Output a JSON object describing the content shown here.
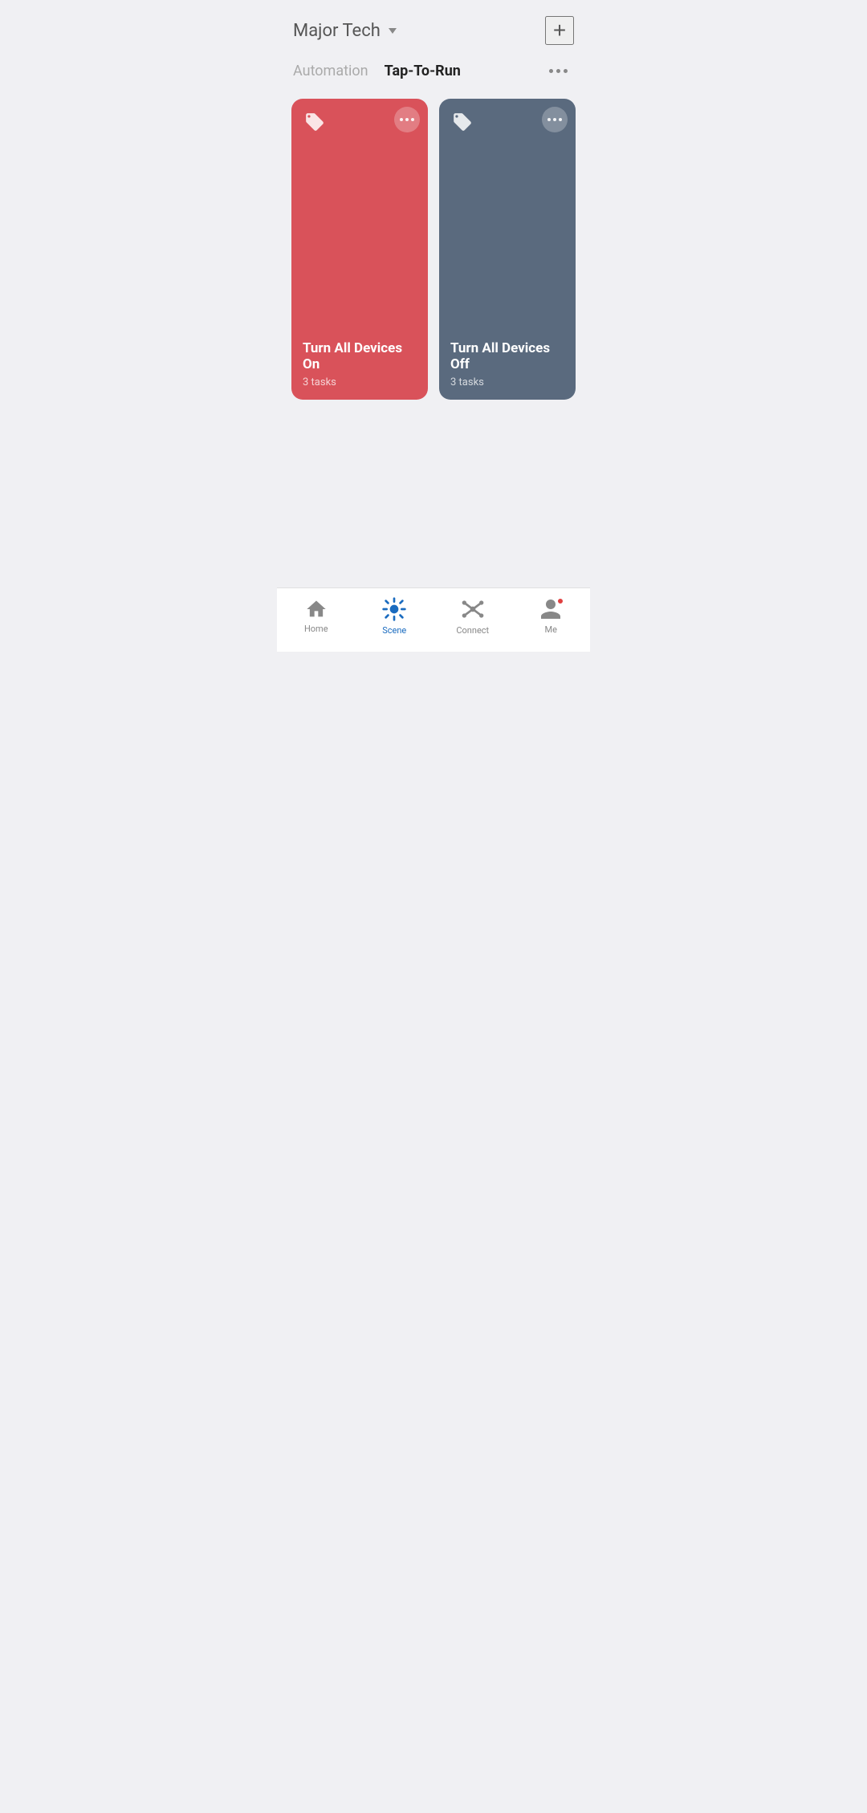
{
  "header": {
    "title": "Major Tech",
    "add_button_label": "+"
  },
  "tabs": [
    {
      "id": "automation",
      "label": "Automation",
      "active": false
    },
    {
      "id": "tap-to-run",
      "label": "Tap-To-Run",
      "active": true
    }
  ],
  "cards": [
    {
      "id": "turn-all-on",
      "title": "Turn All Devices On",
      "subtitle": "3 tasks",
      "color": "on"
    },
    {
      "id": "turn-all-off",
      "title": "Turn All Devices Off",
      "subtitle": "3 tasks",
      "color": "off"
    }
  ],
  "bottom_nav": [
    {
      "id": "home",
      "label": "Home",
      "active": false
    },
    {
      "id": "scene",
      "label": "Scene",
      "active": true
    },
    {
      "id": "connect",
      "label": "Connect",
      "active": false
    },
    {
      "id": "me",
      "label": "Me",
      "active": false,
      "has_badge": true
    }
  ],
  "colors": {
    "card_on": "#d9525a",
    "card_off": "#5a6a7e",
    "active_nav": "#1a6bbf",
    "inactive_nav": "#888888"
  }
}
